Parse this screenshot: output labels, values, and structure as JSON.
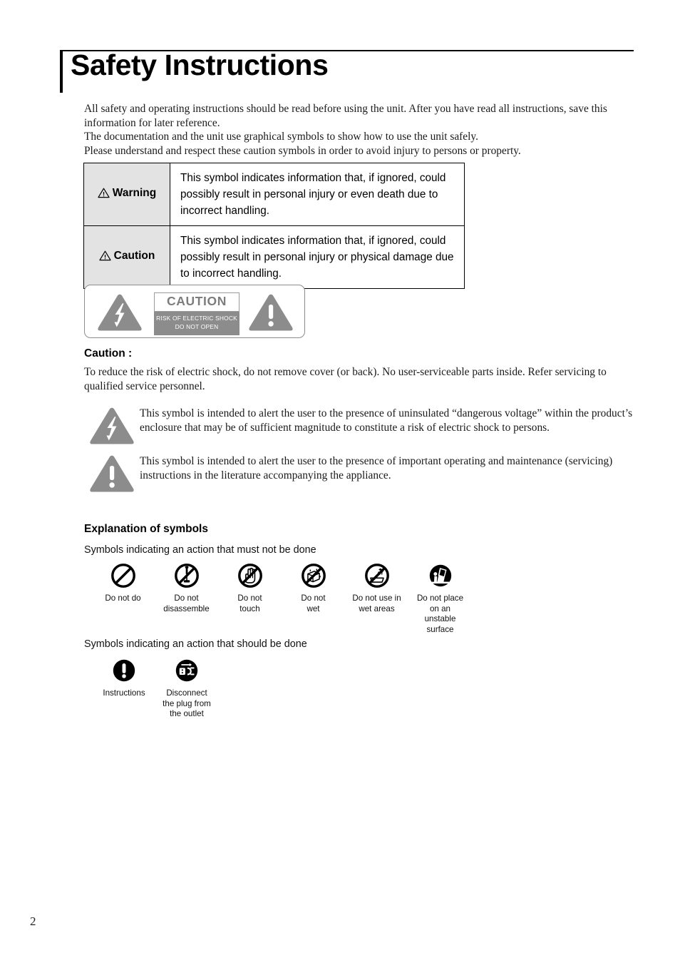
{
  "document": {
    "title": "Safety Instructions",
    "page_number": "2"
  },
  "intro": {
    "line1": "All safety and operating instructions should be read before using the unit. After you have read all instructions, save this information for later reference.",
    "line2": "The documentation and the unit use graphical symbols to show how to use the unit safely.",
    "line3": "Please understand and respect these caution symbols in order to avoid injury to persons or property."
  },
  "warning_table": {
    "rows": [
      {
        "label": "Warning",
        "icon": "warning-triangle-icon",
        "text": "This symbol indicates information that, if ignored, could possibly result in personal injury or even death due to incorrect handling."
      },
      {
        "label": "Caution",
        "icon": "warning-triangle-icon",
        "text": "This symbol indicates information that, if ignored, could possibly result in personal injury or physical damage due to incorrect handling."
      }
    ]
  },
  "caution_badge": {
    "left_icon": "lightning-bolt-triangle-icon",
    "right_icon": "exclamation-triangle-icon",
    "word": "CAUTION",
    "sub_line1": "RISK OF ELECTRIC SHOCK",
    "sub_line2": "DO NOT OPEN",
    "colors": {
      "gray": "#8c8c8c",
      "word_text": "#7d7d7d",
      "border": "#8c8c8c"
    }
  },
  "caution_section": {
    "heading": "Caution :",
    "body": "To reduce the risk of electric shock, do not remove cover (or back). No user-serviceable parts inside. Refer servicing to qualified service personnel."
  },
  "symbol_explanations": [
    {
      "icon": "lightning-bolt-triangle-icon",
      "text": "This symbol is intended to alert the user to the presence of uninsulated “dangerous voltage” within the product’s enclosure that may be of sufficient magnitude to constitute a risk of electric shock to persons."
    },
    {
      "icon": "exclamation-triangle-icon",
      "text": "This symbol is intended to alert the user to the presence of important operating and maintenance (servicing) instructions in the literature accompanying the appliance."
    }
  ],
  "explanation_of_symbols": {
    "heading": "Explanation of symbols",
    "prohibited_subtitle": "Symbols indicating an action that must not be done",
    "prohibited_icons": [
      {
        "icon": "prohibition-plain-icon",
        "label": "Do not do"
      },
      {
        "icon": "prohibition-disassemble-icon",
        "label": "Do not\ndisassemble"
      },
      {
        "icon": "prohibition-touch-icon",
        "label": "Do not\ntouch"
      },
      {
        "icon": "prohibition-wet-icon",
        "label": "Do not\nwet"
      },
      {
        "icon": "prohibition-wet-areas-icon",
        "label": "Do not use in\nwet areas"
      },
      {
        "icon": "prohibition-unstable-surface-icon",
        "label": "Do not place\non an\nunstable\nsurface"
      }
    ],
    "mandatory_subtitle": "Symbols indicating an action that should be done",
    "mandatory_icons": [
      {
        "icon": "mandatory-instructions-icon",
        "label": "Instructions"
      },
      {
        "icon": "mandatory-disconnect-plug-icon",
        "label": "Disconnect\nthe plug from\nthe outlet"
      }
    ]
  }
}
